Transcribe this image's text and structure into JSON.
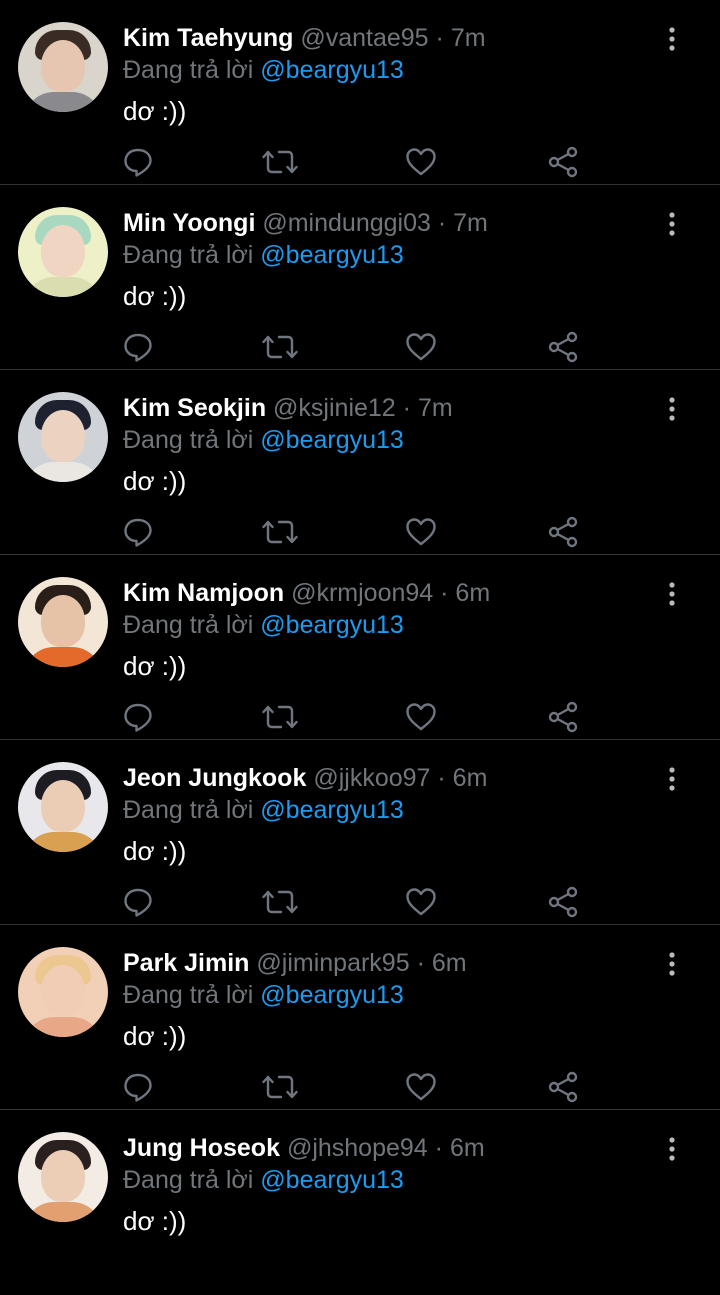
{
  "reply_prefix": "Đang trả lời",
  "colors": {
    "background": "#000000",
    "name": "#ffffff",
    "meta": "#71767b",
    "mention": "#1d9bf0",
    "divider": "#2f3336"
  },
  "icons": {
    "reply": "reply-icon",
    "retweet": "retweet-icon",
    "like": "like-icon",
    "share": "share-icon",
    "more": "more-vertical-icon"
  },
  "tweets": [
    {
      "name": "Kim Taehyung",
      "handle": "@vantae95",
      "time": "7m",
      "reply_to": "@beargyu13",
      "text": "dơ :))"
    },
    {
      "name": "Min Yoongi",
      "handle": "@mindunggi03",
      "time": "7m",
      "reply_to": "@beargyu13",
      "text": "dơ :))"
    },
    {
      "name": "Kim Seokjin",
      "handle": "@ksjinie12",
      "time": "7m",
      "reply_to": "@beargyu13",
      "text": "dơ :))"
    },
    {
      "name": "Kim Namjoon",
      "handle": "@krmjoon94",
      "time": "6m",
      "reply_to": "@beargyu13",
      "text": "dơ :))"
    },
    {
      "name": "Jeon Jungkook",
      "handle": "@jjkkoo97",
      "time": "6m",
      "reply_to": "@beargyu13",
      "text": "dơ :))"
    },
    {
      "name": "Park Jimin",
      "handle": "@jiminpark95",
      "time": "6m",
      "reply_to": "@beargyu13",
      "text": "dơ :))"
    },
    {
      "name": "Jung Hoseok",
      "handle": "@jhshope94",
      "time": "6m",
      "reply_to": "@beargyu13",
      "text": "dơ :))"
    }
  ]
}
